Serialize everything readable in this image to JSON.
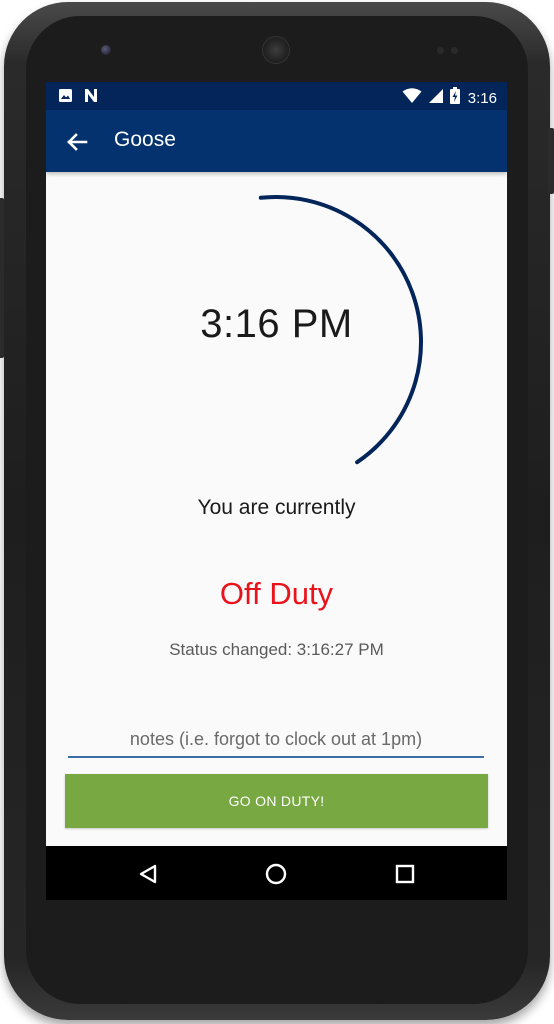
{
  "status_bar": {
    "time": "3:16",
    "left_icons": [
      "image-icon",
      "n-notification-icon"
    ],
    "right_icons": [
      "wifi-icon",
      "cell-signal-icon",
      "battery-charging-icon"
    ]
  },
  "app_bar": {
    "title": "Goose",
    "back_icon": "arrow-back-icon",
    "color": "#03326e"
  },
  "clock": {
    "time": "3:16 PM",
    "arc_color": "#03255a"
  },
  "status": {
    "label": "You are currently",
    "value": "Off Duty",
    "value_color": "#e8131b",
    "changed_text": "Status changed: 3:16:27 PM"
  },
  "notes": {
    "placeholder": "notes (i.e. forgot to clock out at 1pm)",
    "value": ""
  },
  "action": {
    "label": "GO ON DUTY!",
    "color": "#77a841"
  },
  "nav_bar": {
    "buttons": [
      "back-triangle-icon",
      "home-circle-icon",
      "recents-square-icon"
    ]
  }
}
